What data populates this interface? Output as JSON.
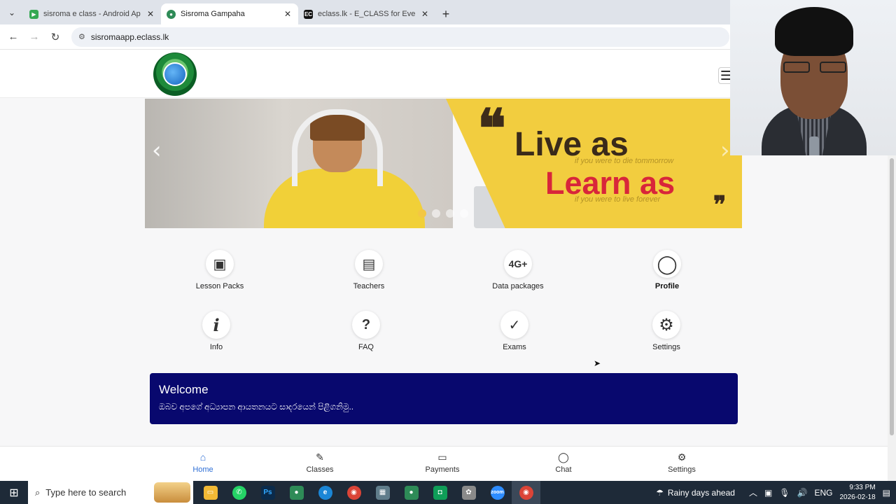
{
  "browser": {
    "tabs": [
      {
        "title": "sisroma e class - Android Apps",
        "favicon_color": "#34a853",
        "favicon_text": "▶",
        "active": false
      },
      {
        "title": "Sisroma Gampaha",
        "favicon_color": "#2e8b57",
        "favicon_text": "●",
        "active": true
      },
      {
        "title": "eclass.lk - E_CLASS for Every Cl",
        "favicon_color": "#111111",
        "favicon_text": "EC",
        "active": false
      }
    ],
    "new_tab": "+",
    "url": "sisromaapp.eclass.lk"
  },
  "carousel": {
    "quote_line1": "Live as",
    "quote_sub1": "if you were to die tommorrow",
    "quote_line2": "Learn as",
    "quote_sub2": "if you were to live forever",
    "prev_icon": "‹",
    "next_icon": "›",
    "slide_count": 4,
    "active_slide": 1
  },
  "menu": [
    {
      "label": "Lesson Packs",
      "icon": "lesson-packs-icon",
      "glyph": "▣",
      "strong": false
    },
    {
      "label": "Teachers",
      "icon": "teacher-board-icon",
      "glyph": "▤",
      "strong": false
    },
    {
      "label": "Data packages",
      "icon": "4g-icon",
      "glyph": "4G+",
      "strong": false
    },
    {
      "label": "Profile",
      "icon": "user-profile-icon",
      "glyph": "◯",
      "strong": true
    },
    {
      "label": "Info",
      "icon": "info-icon",
      "glyph": "i",
      "strong": false
    },
    {
      "label": "FAQ",
      "icon": "question-icon",
      "glyph": "?",
      "strong": false
    },
    {
      "label": "Exams",
      "icon": "exam-check-icon",
      "glyph": "✓",
      "strong": false
    },
    {
      "label": "Settings",
      "icon": "gear-icon",
      "glyph": "⚙",
      "strong": false
    }
  ],
  "welcome": {
    "title": "Welcome",
    "text": "ඔබව අපගේ අධ්‍යාපන ආයතනයට සාදරයෙන් පිළිගනිමු.."
  },
  "bottom_nav": [
    {
      "label": "Home",
      "glyph": "⌂",
      "active": true
    },
    {
      "label": "Classes",
      "glyph": "✎",
      "active": false
    },
    {
      "label": "Payments",
      "glyph": "▭",
      "active": false
    },
    {
      "label": "Chat",
      "glyph": "◯",
      "active": false
    },
    {
      "label": "Settings",
      "glyph": "⚙",
      "active": false
    }
  ],
  "taskbar": {
    "search_placeholder": "Type here to search",
    "weather": "Rainy days ahead",
    "language": "ENG",
    "time": "9:33 PM",
    "date": "2026-02-18",
    "apps": [
      {
        "name": "file-explorer",
        "color": "#f2b935",
        "text": "▭"
      },
      {
        "name": "whatsapp",
        "color": "#25d366",
        "text": "✆"
      },
      {
        "name": "photoshop",
        "color": "#0b2a4a",
        "text": "Ps"
      },
      {
        "name": "sisroma-app",
        "color": "#2e8b57",
        "text": "●"
      },
      {
        "name": "edge",
        "color": "#1b86d6",
        "text": "e"
      },
      {
        "name": "chrome",
        "color": "#db4437",
        "text": "◉"
      },
      {
        "name": "calculator",
        "color": "#607d8b",
        "text": "▦"
      },
      {
        "name": "sisroma-app-2",
        "color": "#2e8b57",
        "text": "●"
      },
      {
        "name": "camera",
        "color": "#0f9d58",
        "text": "◘"
      },
      {
        "name": "brain-app",
        "color": "#8a8a8a",
        "text": "✿"
      },
      {
        "name": "zoom",
        "color": "#2d8cff",
        "text": "zoom"
      },
      {
        "name": "chrome-active",
        "color": "#db4437",
        "text": "◉"
      }
    ]
  }
}
